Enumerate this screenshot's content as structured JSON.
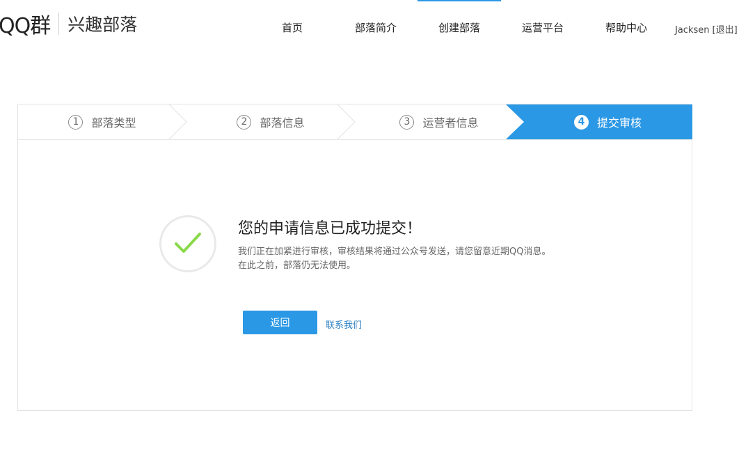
{
  "header": {
    "logo_main": "QQ群",
    "logo_sub": "兴趣部落",
    "nav": [
      {
        "label": "首页"
      },
      {
        "label": "部落简介"
      },
      {
        "label": "创建部落"
      },
      {
        "label": "运营平台"
      },
      {
        "label": "帮助中心"
      }
    ],
    "active_nav_index": 2,
    "user_name": "Jacksen",
    "logout_label": "[退出]"
  },
  "steps": [
    {
      "num": "1",
      "label": "部落类型"
    },
    {
      "num": "2",
      "label": "部落信息"
    },
    {
      "num": "3",
      "label": "运营者信息"
    },
    {
      "num": "4",
      "label": "提交审核"
    }
  ],
  "active_step": 4,
  "result": {
    "icon": "checkmark-icon",
    "title": "您的申请信息已成功提交！",
    "line1": "我们正在加紧进行审核，审核结果将通过公众号发送，请您留意近期QQ消息。",
    "line2": "在此之前，部落仍无法使用。",
    "back_label": "返回",
    "contact_label": "联系我们"
  },
  "colors": {
    "accent": "#2b98e5",
    "check": "#8ad94a",
    "link": "#2b7fc2"
  }
}
